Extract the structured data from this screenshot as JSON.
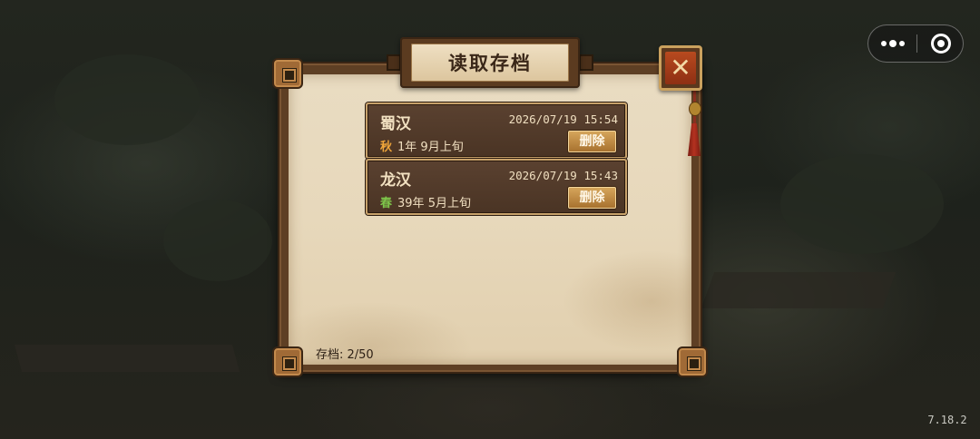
{
  "dialog": {
    "title": "读取存档"
  },
  "saves": [
    {
      "name": "蜀汉",
      "timestamp": "2026/07/19 15:54",
      "season": "秋",
      "season_color": "#f0a63a",
      "date": "1年 9月上旬",
      "delete_label": "删除"
    },
    {
      "name": "龙汉",
      "timestamp": "2026/07/19 15:43",
      "season": "春",
      "season_color": "#7ec64a",
      "date": "39年 5月上旬",
      "delete_label": "删除"
    }
  ],
  "footer": {
    "save_count": "存档: 2/50"
  },
  "system": {
    "version": "7.18.2"
  },
  "icons": {
    "close": "close-icon",
    "more": "more-icon",
    "exit": "exit-icon"
  }
}
